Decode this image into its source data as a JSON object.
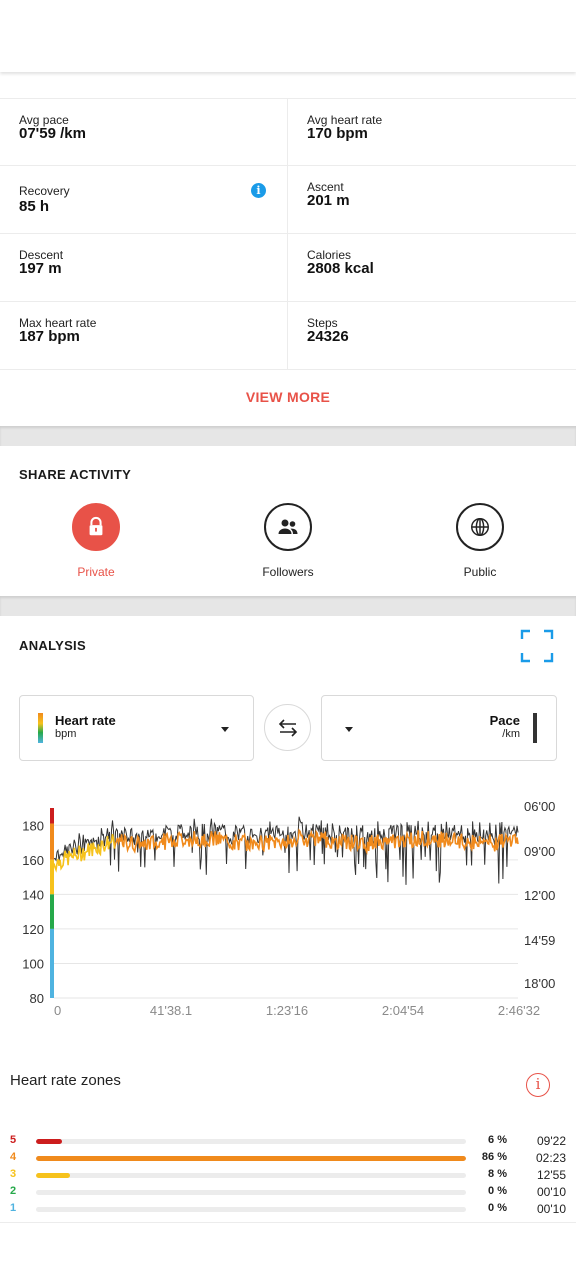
{
  "stats": [
    {
      "left": {
        "label": "Avg pace",
        "value": "07'59 /km"
      },
      "right": {
        "label": "Avg heart rate",
        "value": "170 bpm"
      }
    },
    {
      "left": {
        "label": "Recovery",
        "value": "85 h",
        "info": "i"
      },
      "right": {
        "label": "Ascent",
        "value": "201 m"
      }
    },
    {
      "left": {
        "label": "Descent",
        "value": "197 m"
      },
      "right": {
        "label": "Calories",
        "value": "2808 kcal"
      }
    },
    {
      "left": {
        "label": "Max heart rate",
        "value": "187 bpm"
      },
      "right": {
        "label": "Steps",
        "value": "24326"
      }
    }
  ],
  "view_more": "VIEW MORE",
  "share": {
    "title": "SHARE ACTIVITY",
    "options": [
      {
        "label": "Private",
        "icon": "lock-icon",
        "active": true
      },
      {
        "label": "Followers",
        "icon": "people-icon",
        "active": false
      },
      {
        "label": "Public",
        "icon": "globe-icon",
        "active": false
      }
    ]
  },
  "analysis": {
    "title": "ANALYSIS",
    "left_selector": {
      "title": "Heart rate",
      "unit": "bpm"
    },
    "right_selector": {
      "title": "Pace",
      "unit": "/km"
    }
  },
  "chart_data": {
    "type": "line",
    "x_ticks": [
      "0",
      "41'38.1",
      "1:23'16",
      "2:04'54",
      "2:46'32"
    ],
    "y_left_ticks": [
      "180",
      "160",
      "140",
      "120",
      "100",
      "80"
    ],
    "y_left_range": [
      80,
      190
    ],
    "y_right_ticks": [
      "06'00",
      "09'00",
      "12'00",
      "14'59",
      "18'00"
    ],
    "series": [
      {
        "name": "Heart rate",
        "unit": "bpm",
        "color": "#f08a1c"
      },
      {
        "name": "Pace",
        "unit": "/km",
        "color": "#333333"
      }
    ],
    "zone_bar": [
      {
        "from": 181,
        "to": 190,
        "color": "#cc1d1d"
      },
      {
        "from": 160,
        "to": 181,
        "color": "#f08a1c"
      },
      {
        "from": 140,
        "to": 160,
        "color": "#f6c21c"
      },
      {
        "from": 120,
        "to": 140,
        "color": "#26a94a"
      },
      {
        "from": 80,
        "to": 120,
        "color": "#4fb3e0"
      }
    ],
    "grid": true
  },
  "zones": {
    "title": "Heart rate zones",
    "items": [
      {
        "zone": "5",
        "pct": "6 %",
        "fraction": 0.06,
        "time": "09'22",
        "color": "#cc1d1d"
      },
      {
        "zone": "4",
        "pct": "86 %",
        "fraction": 1.0,
        "time": "02:23",
        "color": "#f08a1c"
      },
      {
        "zone": "3",
        "pct": "8 %",
        "fraction": 0.08,
        "time": "12'55",
        "color": "#f6c21c"
      },
      {
        "zone": "2",
        "pct": "0 %",
        "fraction": 0.0,
        "time": "00'10",
        "color": "#26a94a"
      },
      {
        "zone": "1",
        "pct": "0 %",
        "fraction": 0.0,
        "time": "00'10",
        "color": "#4fb3e0"
      }
    ]
  }
}
